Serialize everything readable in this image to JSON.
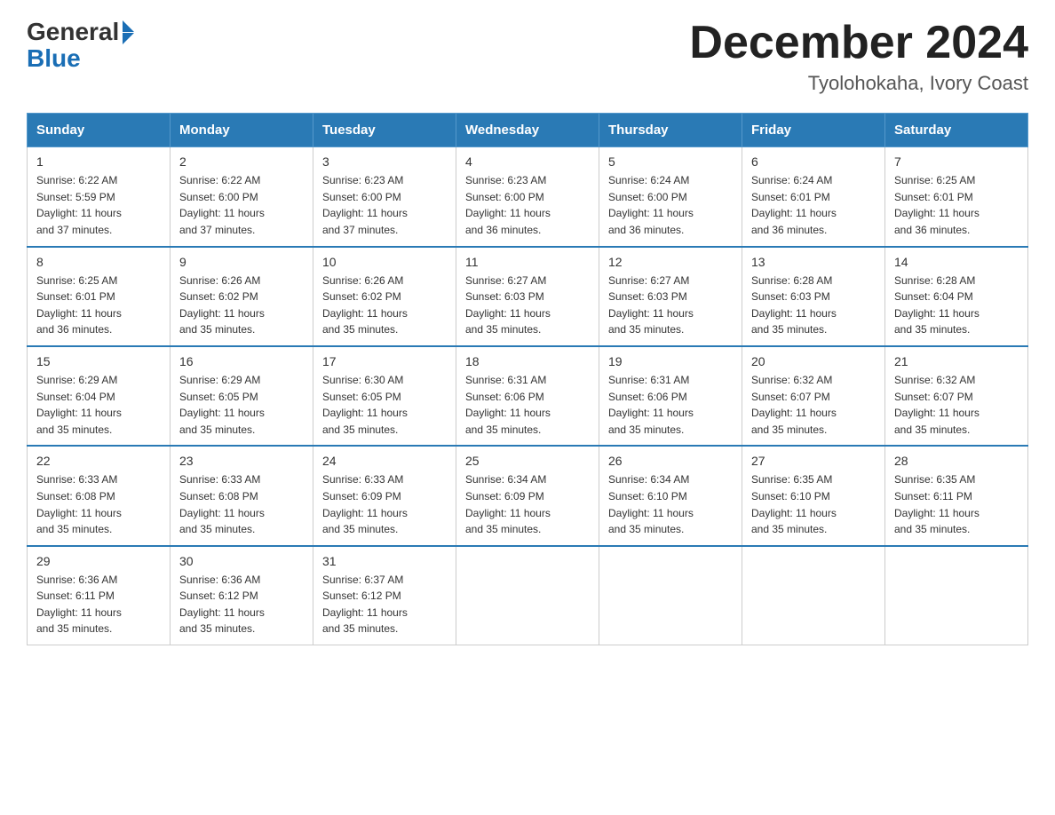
{
  "logo": {
    "general": "General",
    "blue": "Blue",
    "arrow": "▶"
  },
  "title": "December 2024",
  "location": "Tyolohokaha, Ivory Coast",
  "days_of_week": [
    "Sunday",
    "Monday",
    "Tuesday",
    "Wednesday",
    "Thursday",
    "Friday",
    "Saturday"
  ],
  "weeks": [
    [
      {
        "day": "1",
        "sunrise": "6:22 AM",
        "sunset": "5:59 PM",
        "daylight": "11 hours and 37 minutes."
      },
      {
        "day": "2",
        "sunrise": "6:22 AM",
        "sunset": "6:00 PM",
        "daylight": "11 hours and 37 minutes."
      },
      {
        "day": "3",
        "sunrise": "6:23 AM",
        "sunset": "6:00 PM",
        "daylight": "11 hours and 37 minutes."
      },
      {
        "day": "4",
        "sunrise": "6:23 AM",
        "sunset": "6:00 PM",
        "daylight": "11 hours and 36 minutes."
      },
      {
        "day": "5",
        "sunrise": "6:24 AM",
        "sunset": "6:00 PM",
        "daylight": "11 hours and 36 minutes."
      },
      {
        "day": "6",
        "sunrise": "6:24 AM",
        "sunset": "6:01 PM",
        "daylight": "11 hours and 36 minutes."
      },
      {
        "day": "7",
        "sunrise": "6:25 AM",
        "sunset": "6:01 PM",
        "daylight": "11 hours and 36 minutes."
      }
    ],
    [
      {
        "day": "8",
        "sunrise": "6:25 AM",
        "sunset": "6:01 PM",
        "daylight": "11 hours and 36 minutes."
      },
      {
        "day": "9",
        "sunrise": "6:26 AM",
        "sunset": "6:02 PM",
        "daylight": "11 hours and 35 minutes."
      },
      {
        "day": "10",
        "sunrise": "6:26 AM",
        "sunset": "6:02 PM",
        "daylight": "11 hours and 35 minutes."
      },
      {
        "day": "11",
        "sunrise": "6:27 AM",
        "sunset": "6:03 PM",
        "daylight": "11 hours and 35 minutes."
      },
      {
        "day": "12",
        "sunrise": "6:27 AM",
        "sunset": "6:03 PM",
        "daylight": "11 hours and 35 minutes."
      },
      {
        "day": "13",
        "sunrise": "6:28 AM",
        "sunset": "6:03 PM",
        "daylight": "11 hours and 35 minutes."
      },
      {
        "day": "14",
        "sunrise": "6:28 AM",
        "sunset": "6:04 PM",
        "daylight": "11 hours and 35 minutes."
      }
    ],
    [
      {
        "day": "15",
        "sunrise": "6:29 AM",
        "sunset": "6:04 PM",
        "daylight": "11 hours and 35 minutes."
      },
      {
        "day": "16",
        "sunrise": "6:29 AM",
        "sunset": "6:05 PM",
        "daylight": "11 hours and 35 minutes."
      },
      {
        "day": "17",
        "sunrise": "6:30 AM",
        "sunset": "6:05 PM",
        "daylight": "11 hours and 35 minutes."
      },
      {
        "day": "18",
        "sunrise": "6:31 AM",
        "sunset": "6:06 PM",
        "daylight": "11 hours and 35 minutes."
      },
      {
        "day": "19",
        "sunrise": "6:31 AM",
        "sunset": "6:06 PM",
        "daylight": "11 hours and 35 minutes."
      },
      {
        "day": "20",
        "sunrise": "6:32 AM",
        "sunset": "6:07 PM",
        "daylight": "11 hours and 35 minutes."
      },
      {
        "day": "21",
        "sunrise": "6:32 AM",
        "sunset": "6:07 PM",
        "daylight": "11 hours and 35 minutes."
      }
    ],
    [
      {
        "day": "22",
        "sunrise": "6:33 AM",
        "sunset": "6:08 PM",
        "daylight": "11 hours and 35 minutes."
      },
      {
        "day": "23",
        "sunrise": "6:33 AM",
        "sunset": "6:08 PM",
        "daylight": "11 hours and 35 minutes."
      },
      {
        "day": "24",
        "sunrise": "6:33 AM",
        "sunset": "6:09 PM",
        "daylight": "11 hours and 35 minutes."
      },
      {
        "day": "25",
        "sunrise": "6:34 AM",
        "sunset": "6:09 PM",
        "daylight": "11 hours and 35 minutes."
      },
      {
        "day": "26",
        "sunrise": "6:34 AM",
        "sunset": "6:10 PM",
        "daylight": "11 hours and 35 minutes."
      },
      {
        "day": "27",
        "sunrise": "6:35 AM",
        "sunset": "6:10 PM",
        "daylight": "11 hours and 35 minutes."
      },
      {
        "day": "28",
        "sunrise": "6:35 AM",
        "sunset": "6:11 PM",
        "daylight": "11 hours and 35 minutes."
      }
    ],
    [
      {
        "day": "29",
        "sunrise": "6:36 AM",
        "sunset": "6:11 PM",
        "daylight": "11 hours and 35 minutes."
      },
      {
        "day": "30",
        "sunrise": "6:36 AM",
        "sunset": "6:12 PM",
        "daylight": "11 hours and 35 minutes."
      },
      {
        "day": "31",
        "sunrise": "6:37 AM",
        "sunset": "6:12 PM",
        "daylight": "11 hours and 35 minutes."
      },
      null,
      null,
      null,
      null
    ]
  ],
  "labels": {
    "sunrise": "Sunrise:",
    "sunset": "Sunset:",
    "daylight": "Daylight:"
  }
}
